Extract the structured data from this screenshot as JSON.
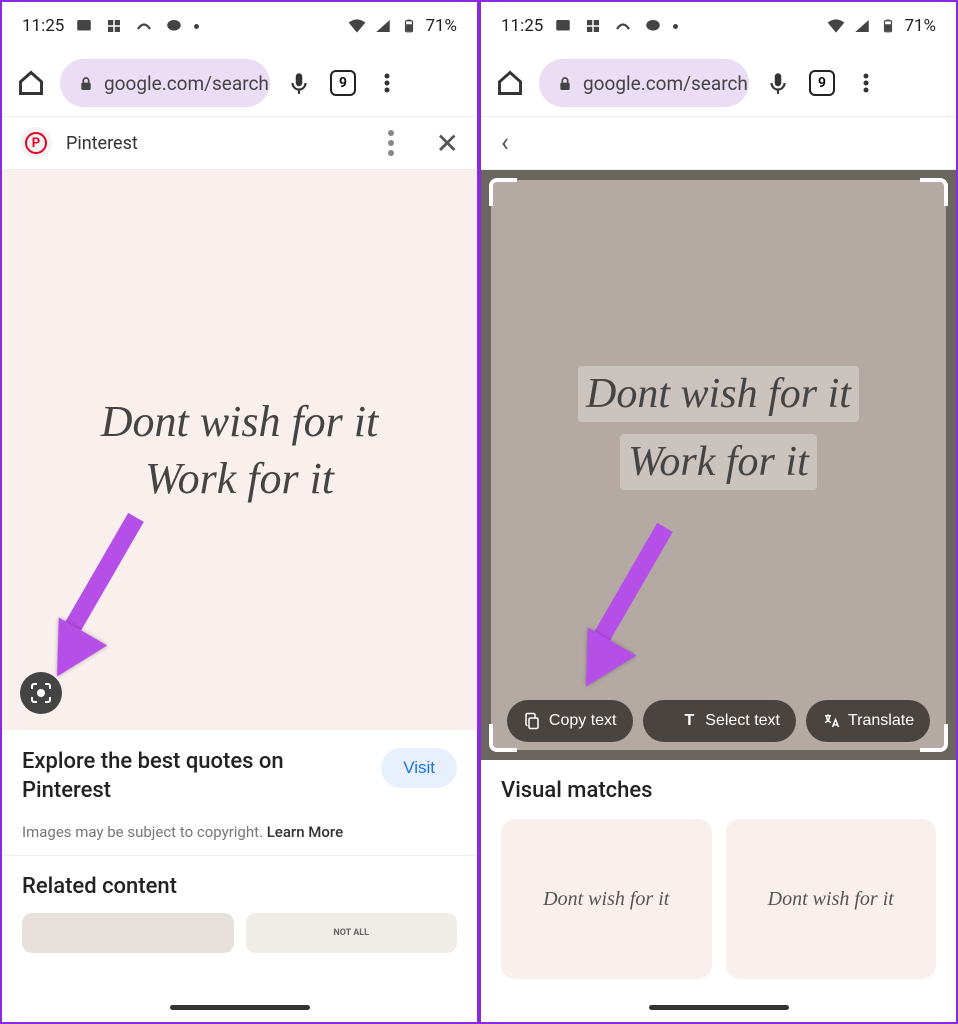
{
  "status": {
    "time": "11:25",
    "battery": "71%"
  },
  "browser": {
    "url": "google.com/search?q",
    "tabs": "9"
  },
  "left": {
    "source": "Pinterest",
    "quote_line1": "Dont wish for it",
    "quote_line2": "Work for it",
    "info_title": "Explore the best quotes on Pinterest",
    "visit": "Visit",
    "copyright": "Images may be subject to copyright. ",
    "learn_more": "Learn More",
    "related_title": "Related content",
    "thumb2_text": "NOT ALL"
  },
  "right": {
    "quote_line1": "Dont wish for it",
    "quote_line2": "Work for it",
    "copy": "Copy text",
    "select": "Select text",
    "translate": "Translate",
    "visual_title": "Visual matches",
    "match_text": "Dont wish for it"
  }
}
